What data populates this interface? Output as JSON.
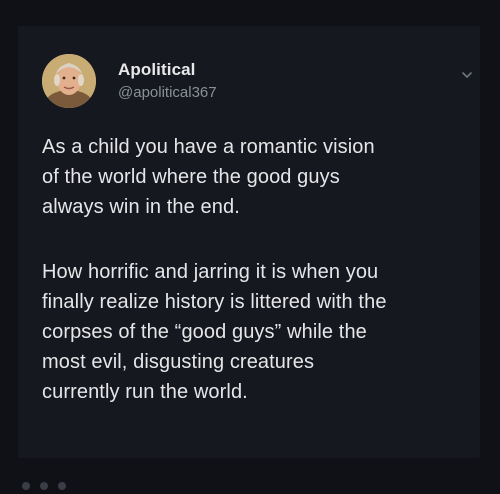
{
  "tweet": {
    "author_name": "Apolitical",
    "author_handle": "@apolitical367",
    "paragraph1": [
      "As a child you have a romantic vision",
      "of the world where the good guys",
      "always win in the end."
    ],
    "paragraph2": [
      "How horrific and jarring it is when you",
      "finally realize history is littered with the",
      "corpses of the “good guys” while the",
      "most evil, disgusting creatures",
      "currently run the world."
    ]
  },
  "icons": {
    "avatar": "portrait-avatar",
    "menu": "chevron-down-icon"
  },
  "colors": {
    "background": "#0f1116",
    "card": "#15181f",
    "text": "#e6e6e8",
    "handle": "#8a8f98"
  }
}
